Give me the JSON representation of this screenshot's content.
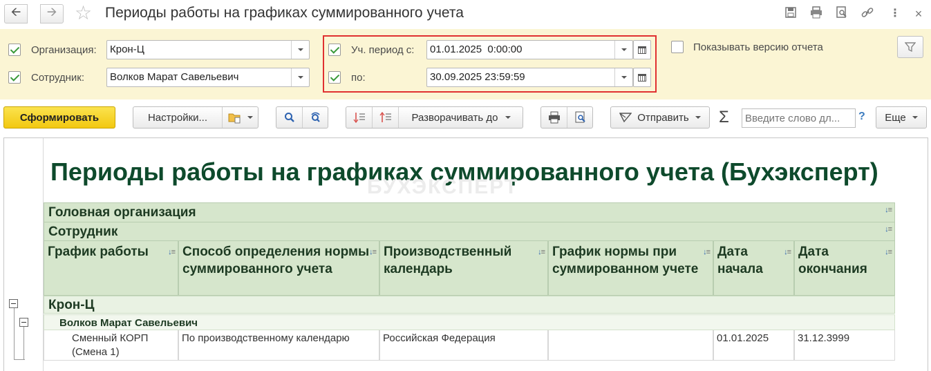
{
  "window": {
    "title": "Периоды работы на графиках суммированного учета",
    "back_icon": "arrow-left-icon",
    "forward_icon": "arrow-right-icon"
  },
  "filters": {
    "organization": {
      "label": "Организация:",
      "value": "Крон-Ц",
      "checked": true
    },
    "employee": {
      "label": "Сотрудник:",
      "value": "Волков Марат Савельевич",
      "checked": true
    },
    "period_from": {
      "label": "Уч. период с:",
      "value": "01.01.2025  0:00:00",
      "checked": true
    },
    "period_to": {
      "label": "по:",
      "value": "30.09.2025 23:59:59",
      "checked": true
    },
    "show_version": {
      "label": "Показывать версию отчета",
      "checked": false
    }
  },
  "toolbar": {
    "generate": "Сформировать",
    "settings": "Настройки...",
    "expand_to": "Разворачивать до",
    "send": "Отправить",
    "search_placeholder": "Введите слово дл...",
    "help": "?",
    "more": "Еще"
  },
  "report": {
    "title": "Периоды работы на графиках суммированного учета (Бухэксперт)",
    "watermark": "БУХЭКСПЕРТ",
    "group_header_1": "Головная организация",
    "group_header_2": "Сотрудник",
    "columns": [
      "График работы",
      "Способ определения нормы суммированного учета",
      "Производственный календарь",
      "График нормы при суммированном учете",
      "Дата начала",
      "Дата окончания"
    ],
    "org_row": "Крон-Ц",
    "employee_row": "Волков Марат Савельевич",
    "rows": [
      [
        "Сменный КОРП (Смена 1)",
        "По производственному календарю",
        "Российская Федерация",
        "",
        "01.01.2025",
        "31.12.3999"
      ]
    ]
  }
}
